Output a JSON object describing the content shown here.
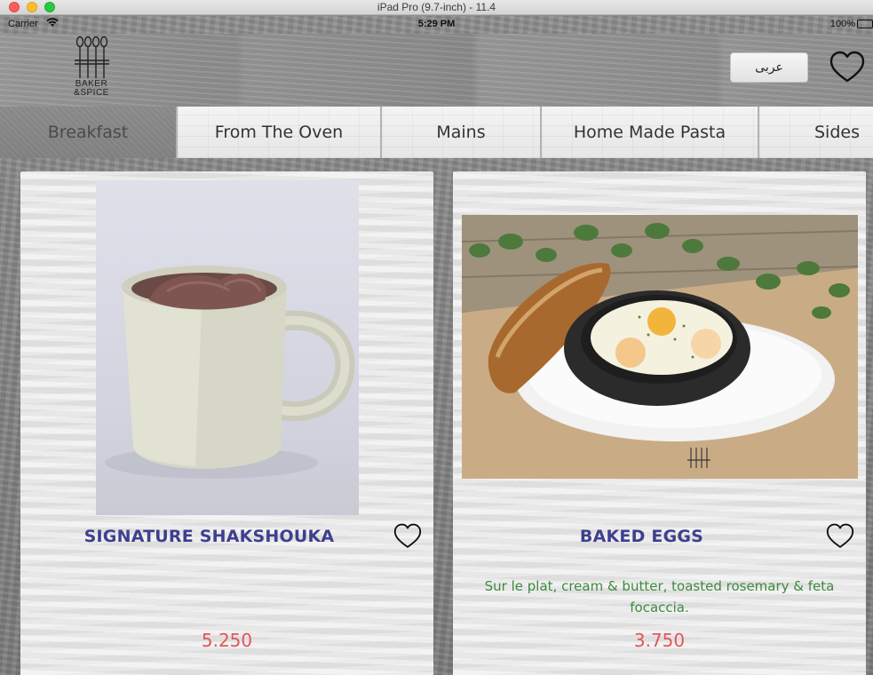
{
  "window": {
    "title": "iPad Pro (9.7-inch) - 11.4"
  },
  "status_bar": {
    "carrier": "Carrier",
    "time": "5:29 PM",
    "battery": "100%",
    "battery_level": 1.0
  },
  "header": {
    "logo_line1": "BAKER",
    "logo_line2": "&SPICE",
    "language_button": "عربى"
  },
  "tabs": [
    {
      "label": "Breakfast",
      "active": true
    },
    {
      "label": "From The Oven",
      "active": false
    },
    {
      "label": "Mains",
      "active": false
    },
    {
      "label": "Home Made Pasta",
      "active": false
    },
    {
      "label": "Sides",
      "active": false
    }
  ],
  "items": [
    {
      "name": "SIGNATURE SHAKSHOUKA",
      "description": "",
      "price": "5.250"
    },
    {
      "name": "BAKED EGGS",
      "description": "Sur le plat, cream & butter, toasted rosemary & feta focaccia.",
      "price": "3.750"
    }
  ],
  "colors": {
    "item_name": "#3f3f8f",
    "description": "#3e8a3e",
    "price": "#e0565a"
  }
}
